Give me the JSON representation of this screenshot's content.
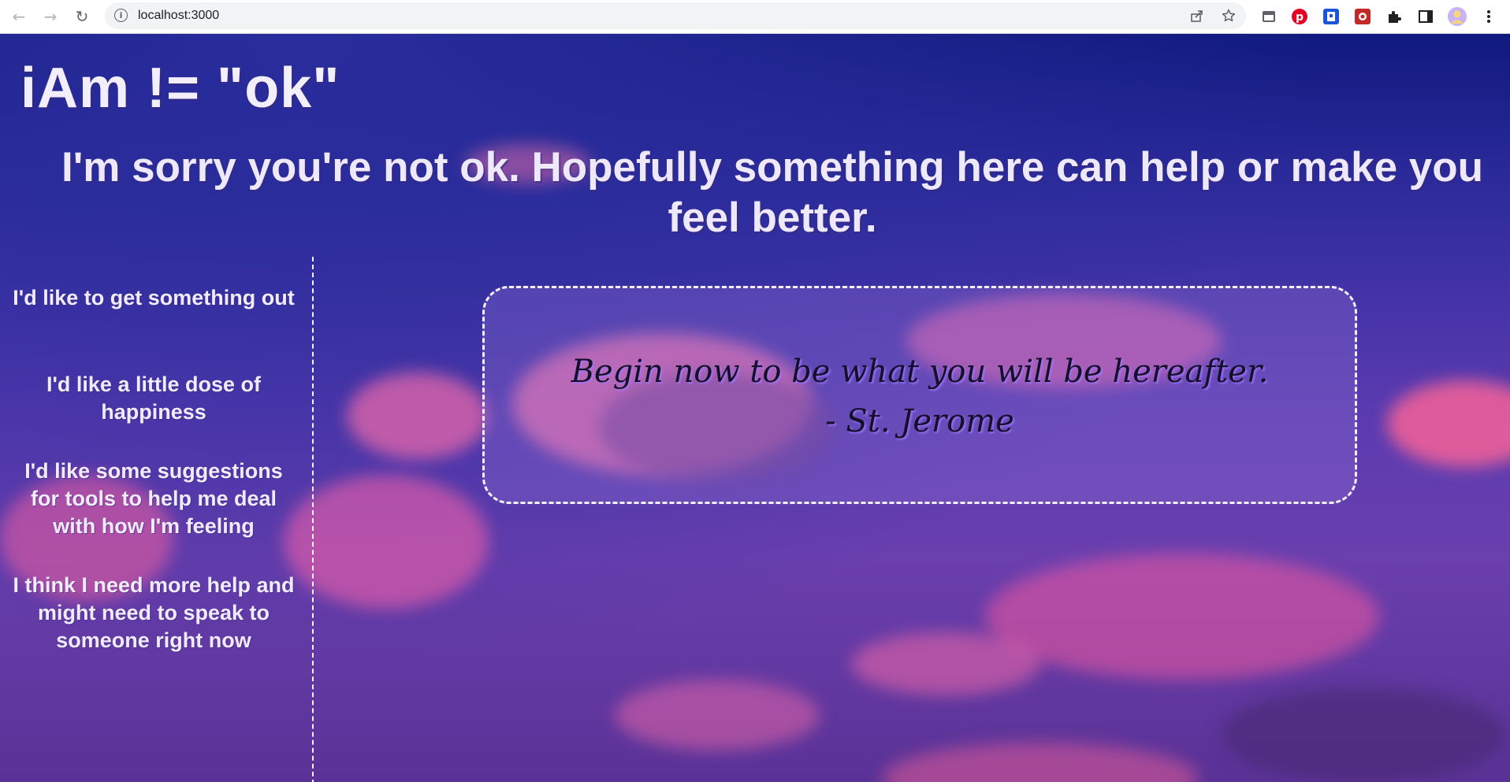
{
  "browser": {
    "url": "localhost:3000",
    "nav": {
      "back_icon": "←",
      "forward_icon": "→",
      "reload_icon": "↻"
    },
    "omnibox_actions": [
      "share-icon",
      "star-icon"
    ],
    "extensions": [
      "tab-search-icon",
      "pinterest-icon",
      "extension-icon",
      "extension-icon-2",
      "puzzle-icon",
      "sidepanel-icon",
      "profile-avatar",
      "menu-icon"
    ]
  },
  "page": {
    "title": "iAm != \"ok\"",
    "tagline": "I'm sorry you're not ok. Hopefully something here can help or make you feel better.",
    "sidebar": {
      "links": [
        {
          "label": "I'd like to get something out"
        },
        {
          "label": "I'd like a little dose of happiness"
        },
        {
          "label": "I'd like some suggestions for tools to help me deal with how I'm feeling"
        },
        {
          "label": "I think I need more help and might need to speak to someone right now"
        }
      ]
    },
    "quote": {
      "text": "Begin now to be what you will be hereafter.",
      "author": "- St. Jerome"
    }
  },
  "colors": {
    "accent": "#f5f0ff",
    "sky_top": "#101a7e",
    "sky_bottom": "#5a3296",
    "cloud": "#ff6fa5"
  }
}
